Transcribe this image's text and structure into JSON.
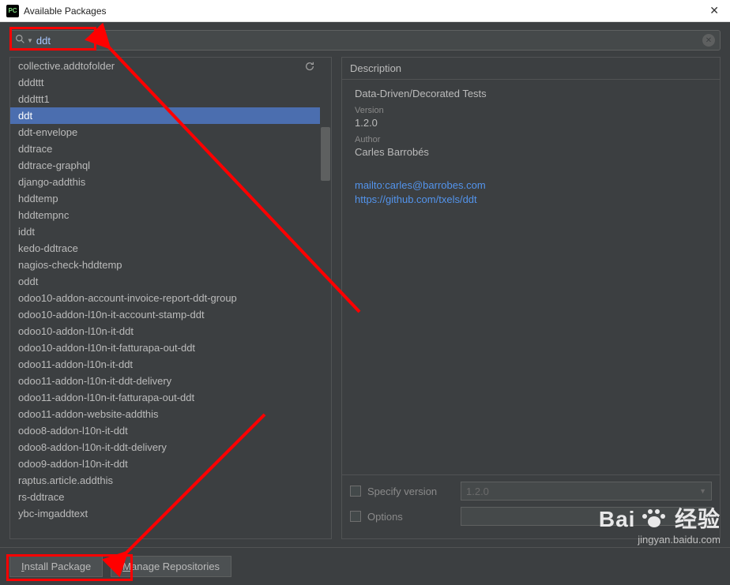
{
  "window": {
    "title": "Available Packages"
  },
  "search": {
    "value": "ddt"
  },
  "packages": [
    "collective.addtofolder",
    "dddttt",
    "dddttt1",
    "ddt",
    "ddt-envelope",
    "ddtrace",
    "ddtrace-graphql",
    "django-addthis",
    "hddtemp",
    "hddtempnc",
    "iddt",
    "kedo-ddtrace",
    "nagios-check-hddtemp",
    "oddt",
    "odoo10-addon-account-invoice-report-ddt-group",
    "odoo10-addon-l10n-it-account-stamp-ddt",
    "odoo10-addon-l10n-it-ddt",
    "odoo10-addon-l10n-it-fatturapa-out-ddt",
    "odoo11-addon-l10n-it-ddt",
    "odoo11-addon-l10n-it-ddt-delivery",
    "odoo11-addon-l10n-it-fatturapa-out-ddt",
    "odoo11-addon-website-addthis",
    "odoo8-addon-l10n-it-ddt",
    "odoo8-addon-l10n-it-ddt-delivery",
    "odoo9-addon-l10n-it-ddt",
    "raptus.article.addthis",
    "rs-ddtrace",
    "ybc-imgaddtext"
  ],
  "selected_index": 3,
  "description": {
    "header": "Description",
    "summary": "Data-Driven/Decorated Tests",
    "version_label": "Version",
    "version": "1.2.0",
    "author_label": "Author",
    "author": "Carles Barrobés",
    "links": [
      "mailto:carles@barrobes.com",
      "https://github.com/txels/ddt"
    ]
  },
  "options": {
    "specify_version_label": "Specify version",
    "specify_version_value": "1.2.0",
    "options_label": "Options"
  },
  "buttons": {
    "install_prefix": "I",
    "install_rest": "nstall Package",
    "manage_prefix": "M",
    "manage_rest": "anage Repositories"
  },
  "watermark": {
    "main1": "Bai",
    "main2": "经验",
    "sub": "jingyan.baidu.com"
  }
}
